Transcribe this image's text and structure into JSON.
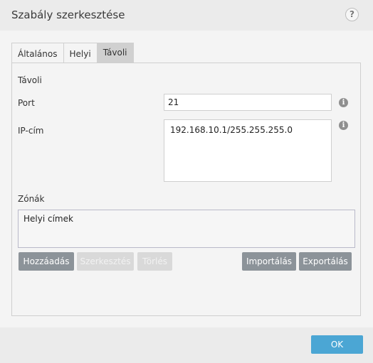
{
  "dialog": {
    "title": "Szabály szerkesztése",
    "help_glyph": "?"
  },
  "tabs": [
    {
      "label": "Általános",
      "active": false
    },
    {
      "label": "Helyi",
      "active": false
    },
    {
      "label": "Távoli",
      "active": true
    }
  ],
  "section": {
    "heading": "Távoli",
    "port_label": "Port",
    "port_value": "21",
    "ip_label": "IP-cím",
    "ip_value": "192.168.10.1/255.255.255.0",
    "info_glyph": "i"
  },
  "zones": {
    "label": "Zónák",
    "items": [
      "Helyi címek"
    ]
  },
  "buttons": {
    "add": "Hozzáadás",
    "edit": "Szerkesztés",
    "delete": "Törlés",
    "import": "Importálás",
    "export": "Exportálás",
    "ok": "OK"
  },
  "colors": {
    "accent": "#4ba6d4",
    "button_enabled": "#8c9399",
    "button_disabled": "#d9d9d9"
  }
}
